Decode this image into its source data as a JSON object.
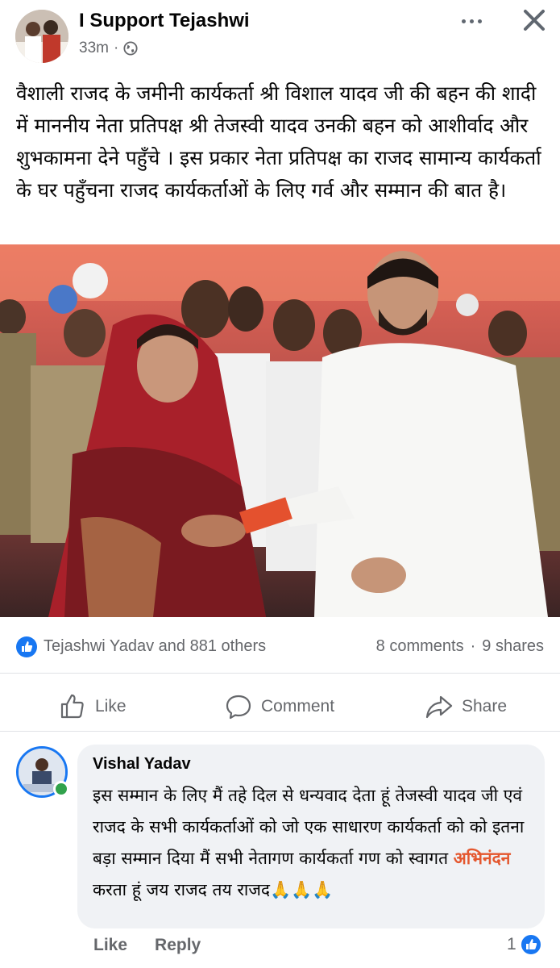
{
  "post": {
    "page_name": "I Support Tejashwi",
    "time": "33m",
    "separator": "·",
    "text": "वैशाली राजद के जमीनी कार्यकर्ता श्री विशाल यादव जी की बहन की शादी में माननीय नेता प्रतिपक्ष श्री तेजस्वी यादव उनकी बहन को आशीर्वाद और शुभकामना देने पहुँचे । इस प्रकार नेता प्रतिपक्ष का राजद सामान्य कार्यकर्ता के घर पहुँचना राजद कार्यकर्ताओं के लिए गर्व और सम्मान की बात है।"
  },
  "reactions": {
    "summary": "Tejashwi Yadav and 881 others",
    "comments": "8 comments",
    "dot": "·",
    "shares": "9 shares"
  },
  "actions": {
    "like": "Like",
    "comment": "Comment",
    "share": "Share"
  },
  "comment": {
    "author": "Vishal Yadav",
    "text_before": "इस सम्मान के लिए मैं तहे दिल से धन्यवाद देता हूं तेजस्वी यादव जी एवं राजद के सभी कार्यकर्ताओं को जो एक साधारण कार्यकर्ता को को इतना बड़ा सम्मान दिया मैं सभी नेतागण कार्यकर्ता गण को स्वागत ",
    "highlight": "अभिनंदन",
    "text_after": " करता हूं जय राजद तय राजद🙏🙏🙏",
    "like_label": "Like",
    "reply_label": "Reply",
    "reaction_count": "1"
  },
  "colors": {
    "facebook_blue": "#1877f2",
    "secondary_text": "#65676b",
    "highlight": "#e4572e",
    "online": "#31a24c"
  },
  "icons": {
    "privacy": "globe-icon",
    "more": "more-icon",
    "close": "close-icon",
    "like": "thumbs-up-icon",
    "comment": "comment-icon",
    "share": "share-icon"
  }
}
